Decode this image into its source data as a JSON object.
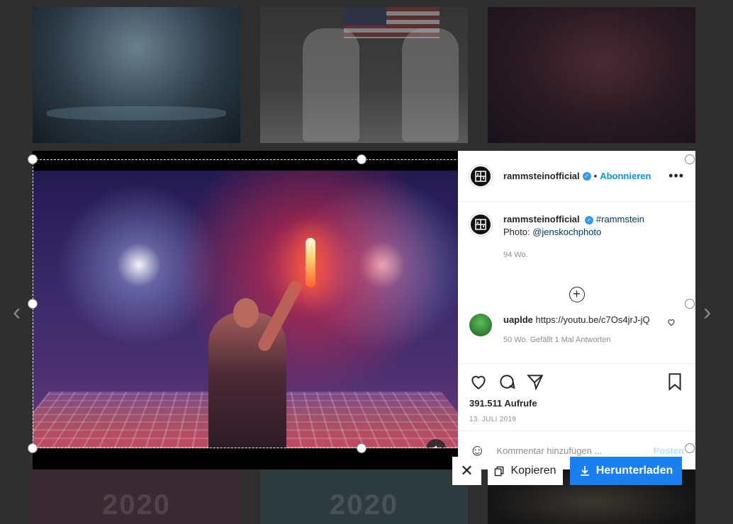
{
  "thumbnails": {
    "bottom_text_left": "2020",
    "bottom_text_mid": "2020"
  },
  "post": {
    "username": "rammsteinofficial",
    "verified_glyph": "✓",
    "separator": "•",
    "follow_label": "Abonnieren",
    "more_glyph": "•••",
    "caption_user": "rammsteinofficial",
    "caption_hashtag": "#rammstein",
    "caption_photo_prefix": "Photo:",
    "caption_photo_handle": "@jenskochphoto",
    "caption_time": "94 Wo.",
    "load_more_glyph": "+",
    "comment": {
      "user": "uaplde",
      "text": "https://youtu.be/c7Os4jrJ-jQ",
      "meta": "50 Wo.    Gefällt 1 Mal    Antworten"
    },
    "views": "391.511 Aufrufe",
    "date": "13. JULI 2019",
    "comment_placeholder": "Kommentar hinzufügen ...",
    "post_label": "Posten"
  },
  "toolbar": {
    "close_glyph": "✕",
    "copy_label": "Kopieren",
    "download_label": "Herunterladen"
  },
  "nav": {
    "prev_glyph": "‹",
    "next_glyph": "›"
  },
  "colors": {
    "accent": "#0095f6",
    "download": "#1a7ff0"
  }
}
